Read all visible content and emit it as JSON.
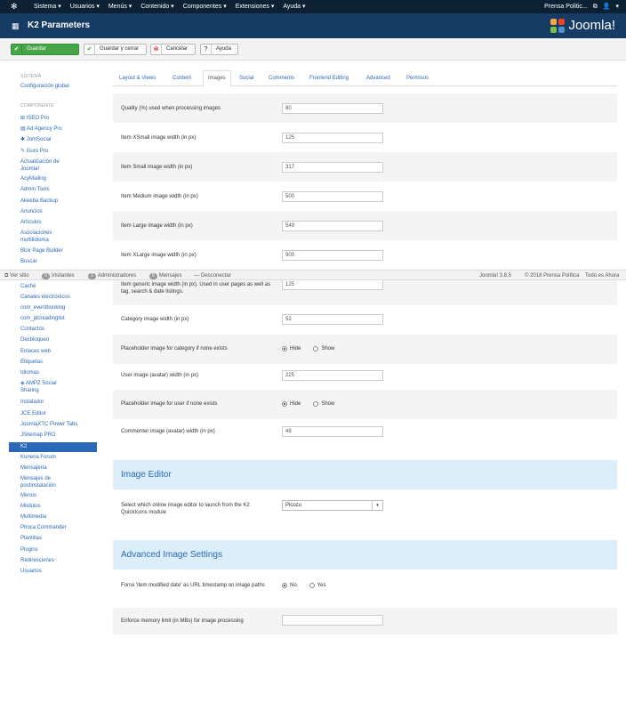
{
  "topnav": {
    "menu": [
      "Sistema ▾",
      "Usuarios ▾",
      "Menús ▾",
      "Contenido ▾",
      "Componentes ▾",
      "Extensiones ▾",
      "Ayuda ▾"
    ],
    "site_name": "Prensa Politic...",
    "user_menu": "▾"
  },
  "titlebar": {
    "title": "K2 Parameters",
    "brand": "Joomla!"
  },
  "toolbar": {
    "save": "Guardar",
    "save_close": "Guardar y cerrar",
    "cancel": "Cancelar",
    "help": "Ayuda"
  },
  "sidebar": {
    "system_heading": "SISTEMA",
    "global_config": "Configuración global",
    "component_heading": "COMPONENTE",
    "items": [
      "ISEO Pro",
      "Ad Agency Pro",
      "JomSocial",
      "Guru Pro",
      "Actualización de Joomla!",
      "AcyMailing",
      "Admin Tools",
      "Akeeba Backup",
      "Anuncios",
      "Artículos",
      "Asociaciones multilidioma",
      "Blox Page Builder",
      "Buscar",
      "Caché",
      "Canales electrónicos",
      "com_eventbooking",
      "com_jdcreadinglist",
      "Contactos",
      "Desbloqueo",
      "Enlaces web",
      "Etiquetas",
      "Idiomas",
      "AMPZ Social Sharing",
      "Instalador",
      "JCE Editor",
      "JoomlaXTC Power Tabs",
      "JSitemap PRO",
      "K2",
      "Kunena Forum",
      "Mensajería",
      "Mensajes de postinstalación",
      "Menús",
      "Módulos",
      "Multimedia",
      "Phoca Commander",
      "Plantillas",
      "Plugins",
      "Redirecciones",
      "Usuarios"
    ],
    "active": "K2"
  },
  "statusbar": {
    "view_site": "Ver sitio",
    "visitors_count": "0",
    "visitors": "Visitantes",
    "admins_count": "3",
    "admins": "Administradores",
    "messages_count": "0",
    "messages": "Mensajes",
    "logout": "Desconectar",
    "version": "Joomla! 3.8.5",
    "copyright": "© 2018 Prensa Política",
    "tagline": "Todo es Ahora"
  },
  "tabs": [
    "Layout & Views",
    "Content",
    "Images",
    "Social",
    "Comments",
    "Frontend Editing",
    "Advanced",
    "Permisos"
  ],
  "active_tab": "Images",
  "fields": {
    "quality": {
      "label": "Quality (%) used when processing images",
      "value": "80"
    },
    "xsmall": {
      "label": "Item XSmall image width (in px)",
      "value": "125"
    },
    "small": {
      "label": "Item Small image width (in px)",
      "value": "317"
    },
    "medium": {
      "label": "Item Medium image width (in px)",
      "value": "500"
    },
    "large": {
      "label": "Item Large image width (in px)",
      "value": "549"
    },
    "xlarge": {
      "label": "Item XLarge image width (in px)",
      "value": "900"
    },
    "generic": {
      "label": "Item generic image width (in px). Used in user pages as well as tag, search & date listings.",
      "value": "125"
    },
    "category": {
      "label": "Category image width (in px)",
      "value": "52"
    },
    "cat_placeholder": {
      "label": "Placeholder image for category if none exists",
      "opt1": "Hide",
      "opt2": "Show"
    },
    "user_avatar": {
      "label": "User image (avatar) width (in px)",
      "value": "225"
    },
    "user_placeholder": {
      "label": "Placeholder image for user if none exists",
      "opt1": "Hide",
      "opt2": "Show"
    },
    "commenter_avatar": {
      "label": "Commenter image (avatar) width (in px)",
      "value": "48"
    }
  },
  "image_editor": {
    "heading": "Image Editor",
    "label": "Select which online image editor to launch from the K2 QuickIcons module",
    "value": "Picozu"
  },
  "advanced_images": {
    "heading": "Advanced Image Settings",
    "force_label": "Force 'item modified date' as URL timestamp on image paths",
    "opt_no": "No",
    "opt_yes": "Yes",
    "memory_label": "Enforce memory limit (in MBs) for image processing",
    "memory_value": ""
  }
}
